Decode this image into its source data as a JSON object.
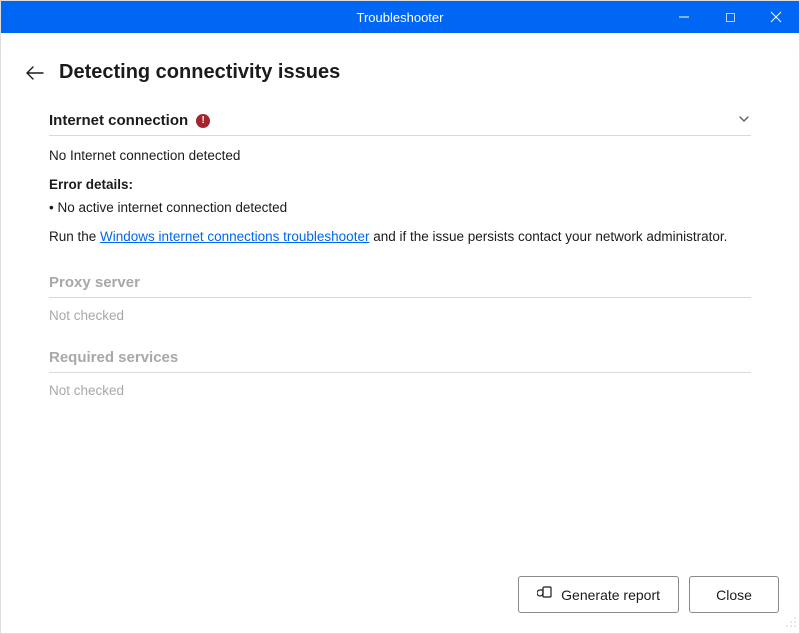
{
  "window": {
    "title": "Troubleshooter"
  },
  "page": {
    "heading": "Detecting connectivity issues"
  },
  "sections": {
    "internet": {
      "title": "Internet connection",
      "summary": "No Internet connection detected",
      "details_label": "Error details:",
      "bullet1": "• No active internet connection detected",
      "run_prefix": "Run the ",
      "link_text": "Windows internet connections troubleshooter",
      "run_suffix": " and if the issue persists contact your network administrator."
    },
    "proxy": {
      "title": "Proxy server",
      "status": "Not checked"
    },
    "services": {
      "title": "Required services",
      "status": "Not checked"
    }
  },
  "buttons": {
    "generate_report": "Generate report",
    "close": "Close"
  }
}
